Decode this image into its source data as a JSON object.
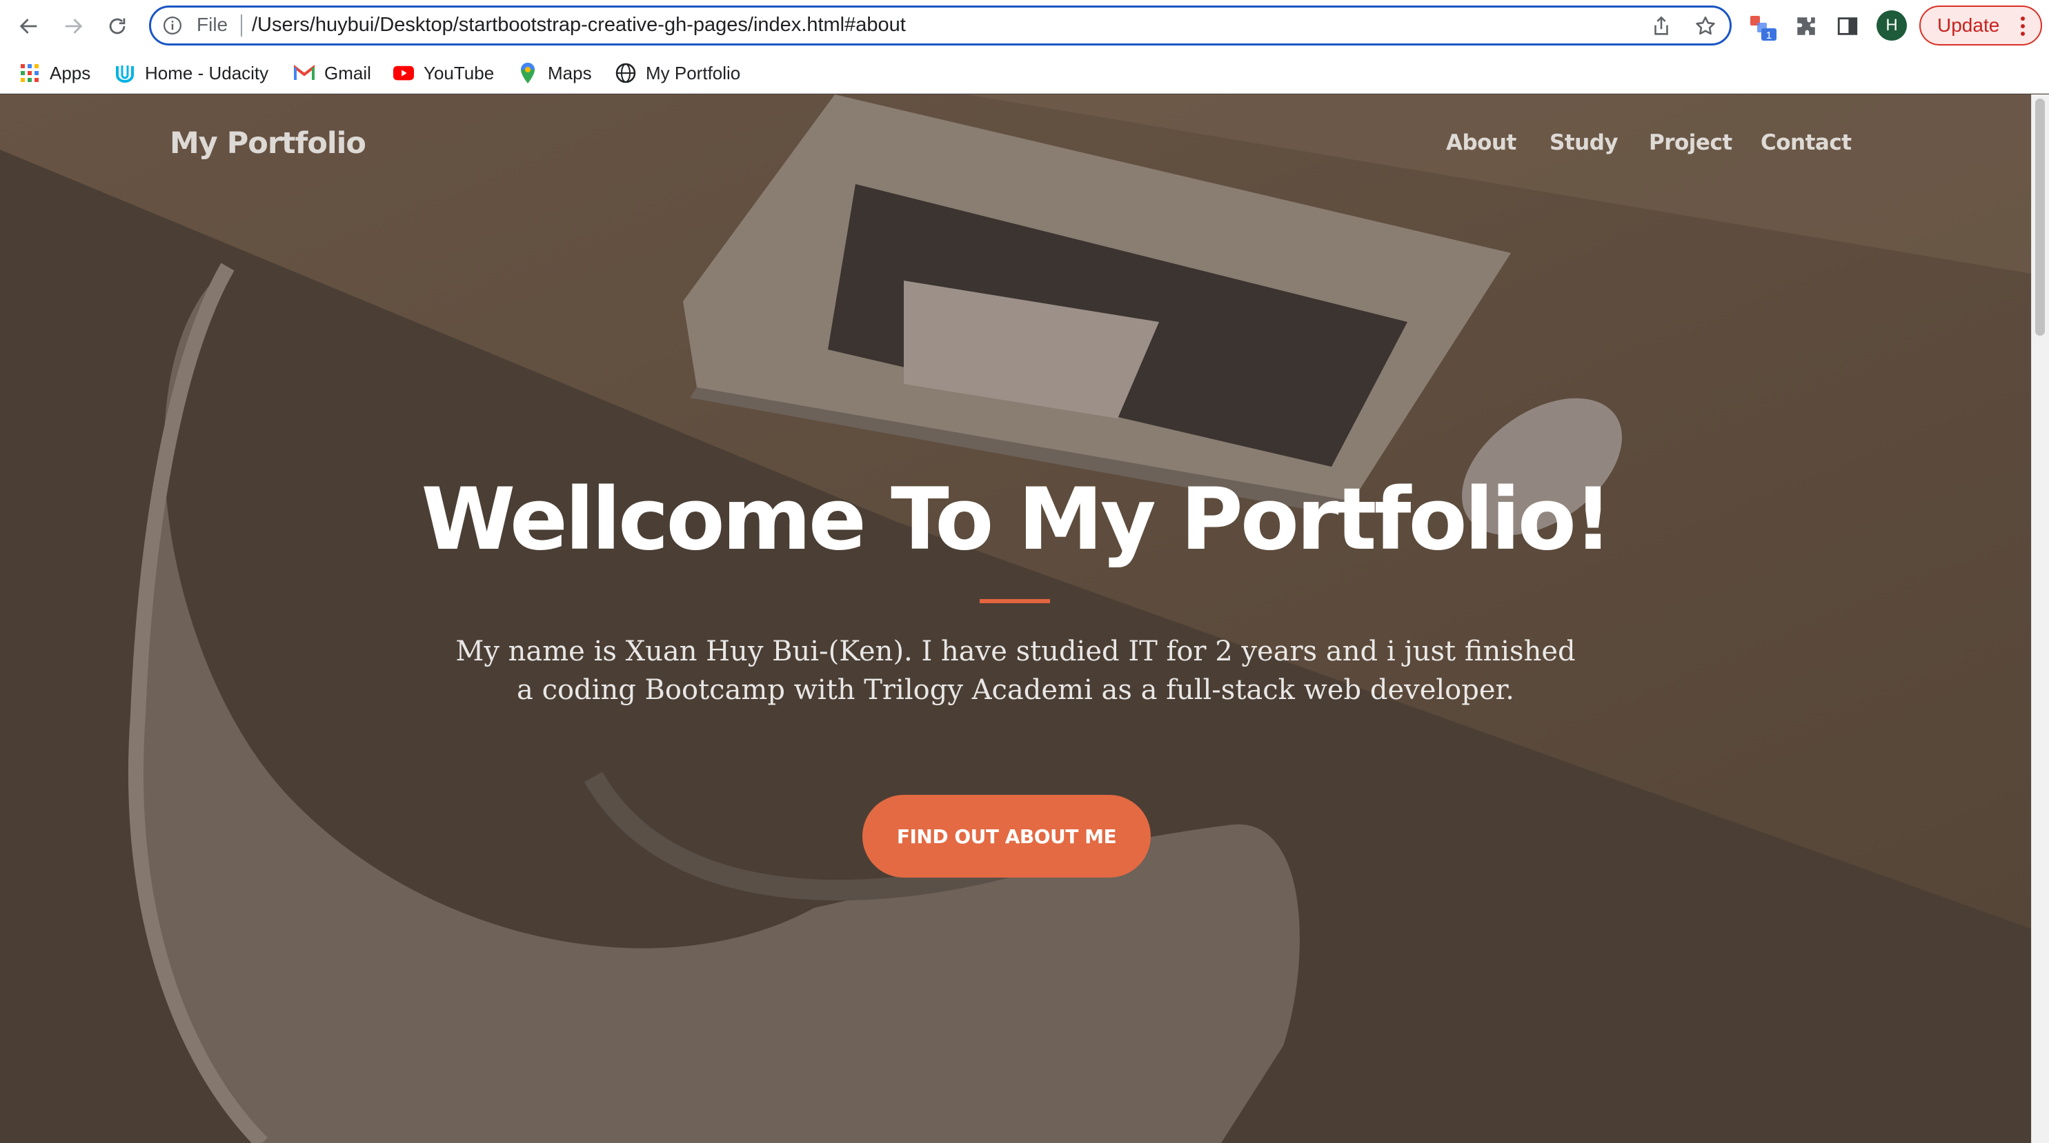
{
  "browser": {
    "address_bar": {
      "scheme_label": "File",
      "url": "/Users/huybui/Desktop/startbootstrap-creative-gh-pages/index.html#about"
    },
    "extension_badge": "1",
    "profile_initial": "H",
    "update_label": "Update",
    "bookmarks": [
      {
        "label": "Apps",
        "icon": "apps-grid-icon"
      },
      {
        "label": "Home - Udacity",
        "icon": "udacity-icon"
      },
      {
        "label": "Gmail",
        "icon": "gmail-icon"
      },
      {
        "label": "YouTube",
        "icon": "youtube-icon"
      },
      {
        "label": "Maps",
        "icon": "maps-icon"
      },
      {
        "label": "My Portfolio",
        "icon": "globe-icon"
      }
    ]
  },
  "site": {
    "brand": "My Portfolio",
    "nav": [
      {
        "label": "About"
      },
      {
        "label": "Study"
      },
      {
        "label": "Project"
      },
      {
        "label": "Contact"
      }
    ],
    "hero": {
      "title": "Wellcome To My Portfolio!",
      "text": "My name is Xuan Huy Bui-(Ken). I have studied IT for 2 years and i just finished a coding Bootcamp with Trilogy Academi as a full-stack web developer.",
      "cta_label": "FIND OUT ABOUT ME"
    },
    "colors": {
      "accent": "#e36a43",
      "overlay": "#4a3f35"
    }
  }
}
